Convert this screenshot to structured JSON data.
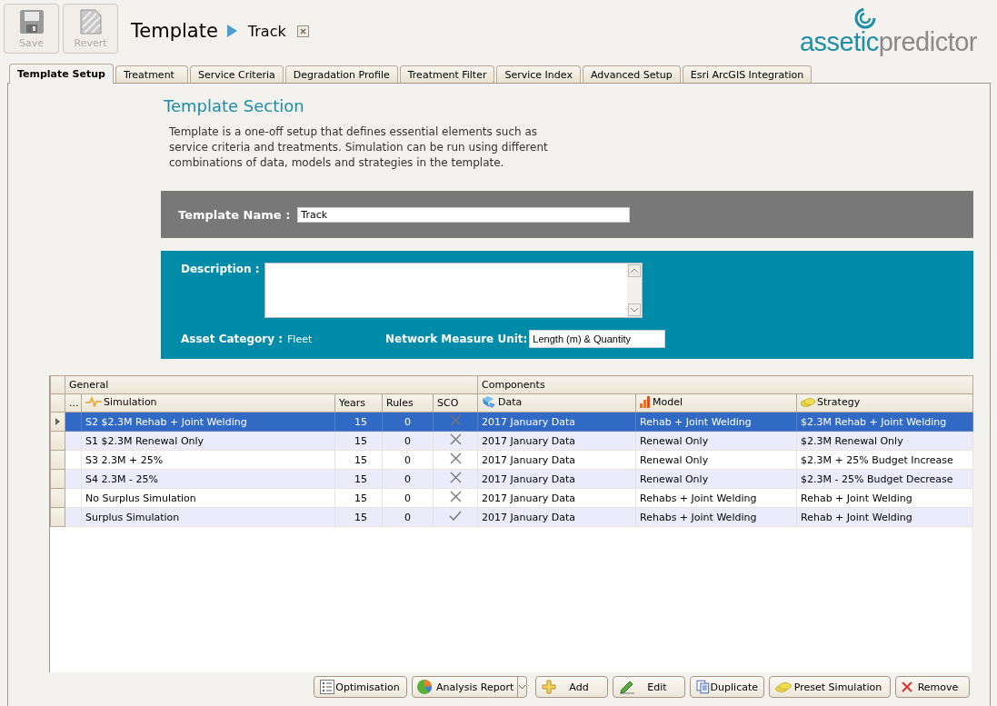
{
  "toolbar": {
    "buttons": [
      {
        "label": "Save",
        "disabled": true
      },
      {
        "label": "Revert",
        "disabled": true
      }
    ]
  },
  "breadcrumb": {
    "title": "Template",
    "current": "Track"
  },
  "logo": {
    "part_1": "assetic",
    "part_2": "predictor"
  },
  "tabs": [
    {
      "label": "Template Setup",
      "selected": true
    },
    {
      "label": "Treatment",
      "selected": false
    },
    {
      "label": "Service Criteria",
      "selected": false
    },
    {
      "label": "Degradation Profile",
      "selected": false
    },
    {
      "label": "Treatment Filter",
      "selected": false
    },
    {
      "label": "Service Index",
      "selected": false
    },
    {
      "label": "Advanced Setup",
      "selected": false
    },
    {
      "label": "Esri ArcGIS Integration",
      "selected": false
    }
  ],
  "section": {
    "title": "Template Section",
    "description": "Template is a one-off setup that defines essential elements such as service criteria and treatments. Simulation can be run using different combinations of data, models and strategies in the template."
  },
  "template_name": {
    "label": "Template Name :",
    "value": "Track"
  },
  "details": {
    "description_label": "Description :",
    "asset_category_label": "Asset Category :",
    "asset_category": "Fleet",
    "network_measure_label": "Network Measure Unit:",
    "network_measure_value": "Length (m) & Quantity"
  },
  "table": {
    "groups": [
      "General",
      "Components"
    ],
    "columns": [
      "...",
      "Simulation",
      "Years",
      "Rules",
      "SCO",
      "Data",
      "Model",
      "Strategy"
    ],
    "rows": [
      {
        "simulation": "S2 $2.3M Rehab + Joint Welding",
        "years": "15",
        "rules": "0",
        "sco": false,
        "data": "2017 January Data",
        "model": "Rehab + Joint Welding",
        "strategy": "$2.3M Rehab + Joint Welding",
        "selected": true
      },
      {
        "simulation": "S1 $2.3M Renewal Only",
        "years": "15",
        "rules": "0",
        "sco": false,
        "data": "2017 January Data",
        "model": "Renewal Only",
        "strategy": "$2.3M Renewal Only",
        "selected": false
      },
      {
        "simulation": "S3 2.3M + 25%",
        "years": "15",
        "rules": "0",
        "sco": false,
        "data": "2017 January Data",
        "model": "Renewal Only",
        "strategy": "$2.3M + 25% Budget Increase",
        "selected": false
      },
      {
        "simulation": "S4 2.3M - 25%",
        "years": "15",
        "rules": "0",
        "sco": false,
        "data": "2017 January Data",
        "model": "Renewal Only",
        "strategy": "$2.3M - 25% Budget Decrease",
        "selected": false
      },
      {
        "simulation": "No Surplus Simulation",
        "years": "15",
        "rules": "0",
        "sco": false,
        "data": "2017 January Data",
        "model": "Rehabs + Joint Welding",
        "strategy": "Rehab + Joint Welding",
        "selected": false
      },
      {
        "simulation": "Surplus Simulation",
        "years": "15",
        "rules": "0",
        "sco": true,
        "data": "2017 January Data",
        "model": "Rehabs + Joint Welding",
        "strategy": "Rehab + Joint Welding",
        "selected": false
      }
    ]
  },
  "actions": [
    {
      "label": "Optimisation",
      "kind": "button"
    },
    {
      "label": "Analysis Report",
      "kind": "split"
    },
    {
      "label": "Add",
      "kind": "button"
    },
    {
      "label": "Edit",
      "kind": "button"
    },
    {
      "label": "Duplicate",
      "kind": "button"
    },
    {
      "label": "Preset Simulation",
      "kind": "button"
    },
    {
      "label": "Remove",
      "kind": "button"
    }
  ]
}
